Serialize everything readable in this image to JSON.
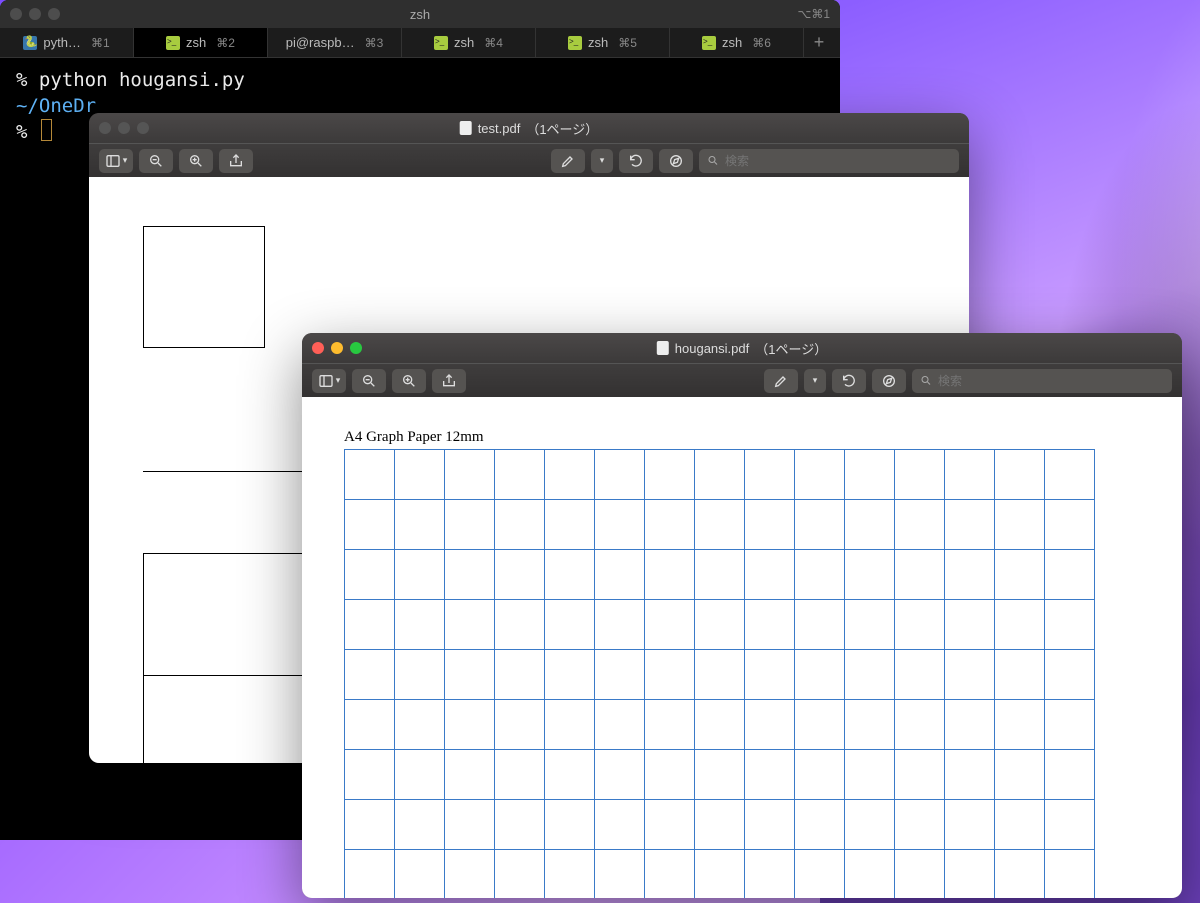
{
  "terminal": {
    "title": "zsh",
    "titlebar_right": "⌥⌘1",
    "tabs": [
      {
        "icon": "python",
        "label": "pyth…",
        "shortcut": "⌘1",
        "active": false
      },
      {
        "icon": "zsh",
        "label": "zsh",
        "shortcut": "⌘2",
        "active": true
      },
      {
        "icon": "",
        "label": "pi@raspb…",
        "shortcut": "⌘3",
        "active": false
      },
      {
        "icon": "zsh",
        "label": "zsh",
        "shortcut": "⌘4",
        "active": false
      },
      {
        "icon": "zsh",
        "label": "zsh",
        "shortcut": "⌘5",
        "active": false
      },
      {
        "icon": "zsh",
        "label": "zsh",
        "shortcut": "⌘6",
        "active": false
      }
    ],
    "lines": {
      "cmd": "% python hougansi.py",
      "path": "~/OneDr",
      "prompt": "% "
    }
  },
  "testpdf": {
    "title_file": "test.pdf",
    "title_pages": "（1ページ）",
    "search_placeholder": "検索"
  },
  "hougansi": {
    "title_file": "hougansi.pdf",
    "title_pages": "（1ページ）",
    "search_placeholder": "検索",
    "graph_title": "A4 Graph Paper 12mm",
    "grid": {
      "cols": 15,
      "rows": 9
    }
  }
}
